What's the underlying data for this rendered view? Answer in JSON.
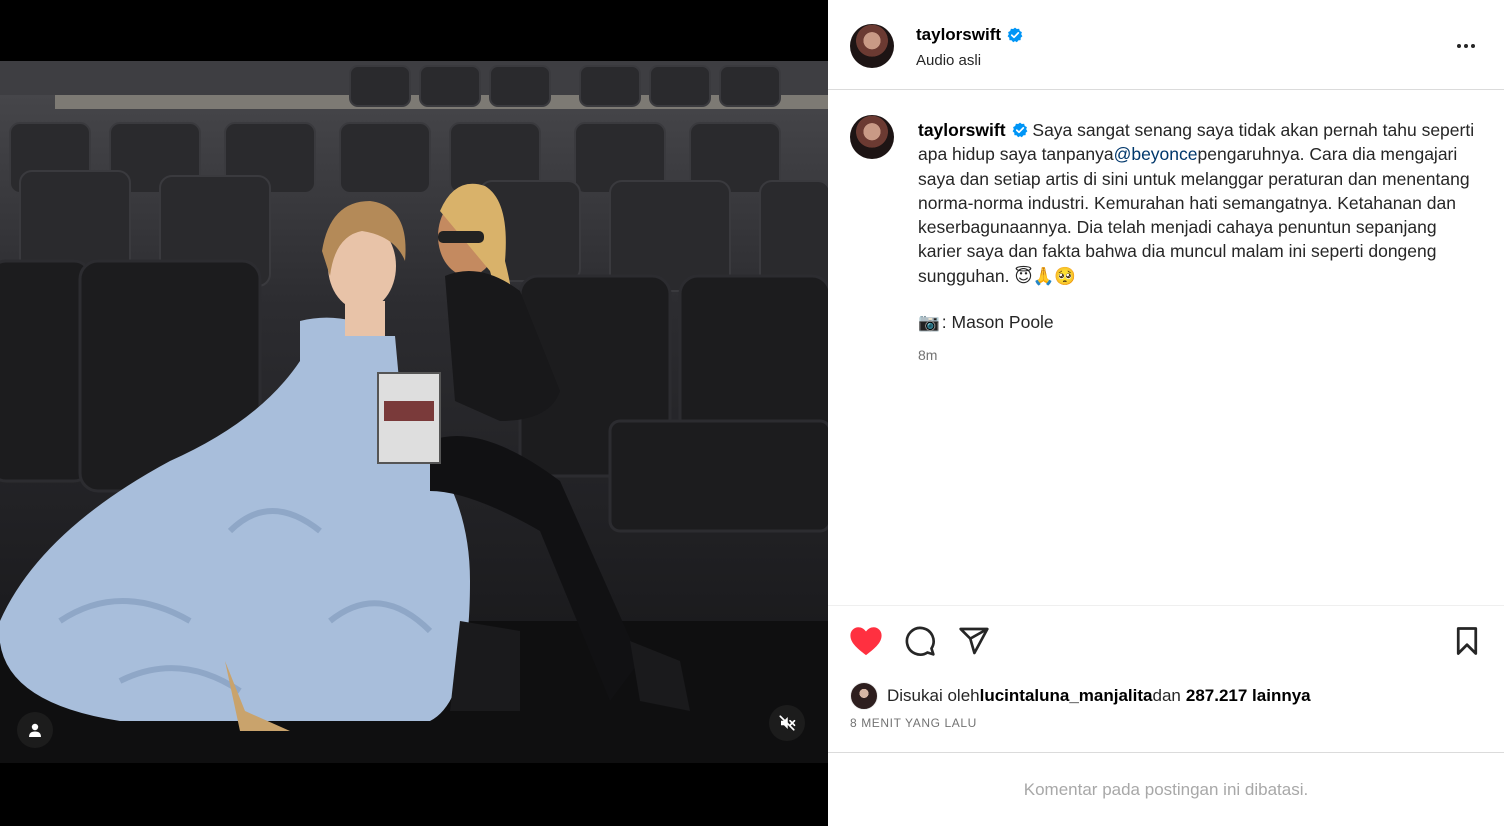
{
  "post": {
    "username": "taylorswift",
    "audio": "Audio asli",
    "verified": true
  },
  "caption": {
    "username": "taylorswift",
    "text_before": " Saya sangat senang saya tidak akan pernah tahu seperti apa hidup saya tanpanya",
    "mention": "@beyonce",
    "text_after": "pengaruhnya. Cara dia mengajari saya dan setiap artis di sini untuk melanggar peraturan dan menentang norma-norma industri. Kemurahan hati semangatnya. Ketahanan dan keserbagunaannya. Dia telah menjadi cahaya penuntun sepanjang karier saya dan fakta bahwa dia muncul malam ini seperti dongeng sungguhan. 😇🙏🥺",
    "credit_icon": "📷",
    "credit": ": Mason Poole",
    "time": "8m"
  },
  "actions": {
    "like_icon": "heart-filled",
    "like_color": "#ff3040",
    "comment_icon": "comment-bubble",
    "share_icon": "paper-plane",
    "save_icon": "bookmark"
  },
  "likes": {
    "prefix": "Disukai oleh",
    "user": "lucintaluna_manjalita",
    "middle": "dan",
    "count": "287.217 lainnya"
  },
  "post_date": "8 MENIT YANG LALU",
  "comments_notice": "Komentar pada postingan ini dibatasi.",
  "colors": {
    "verified_badge": "#0095f6",
    "mention_link": "#00376b",
    "secondary_text": "#737373"
  }
}
